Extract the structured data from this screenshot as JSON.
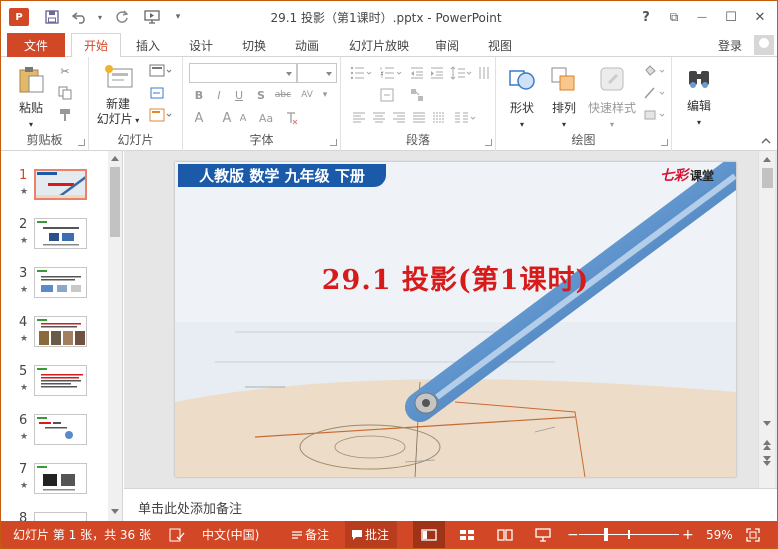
{
  "app": {
    "logo_text": "P",
    "doc_title": "29.1 投影（第1课时）.pptx - PowerPoint"
  },
  "qat": {
    "save_icon": "save-icon",
    "undo_icon": "undo-icon",
    "redo_icon": "redo-icon",
    "present_icon": "from-beginning-icon"
  },
  "window_controls": {
    "help": "?",
    "restore_ribbon": "⧉",
    "minimize": "—",
    "maximize": "☐",
    "close": "✕"
  },
  "tabs": {
    "file": "文件",
    "items": [
      "开始",
      "插入",
      "设计",
      "切换",
      "动画",
      "幻灯片放映",
      "审阅",
      "视图"
    ],
    "active": "开始",
    "login": "登录"
  },
  "ribbon": {
    "clipboard": {
      "label": "剪贴板",
      "paste": "粘贴"
    },
    "slides": {
      "label": "幻灯片",
      "new_slide_line1": "新建",
      "new_slide_line2": "幻灯片"
    },
    "font": {
      "label": "字体",
      "font_name": "",
      "font_size": ""
    },
    "paragraph": {
      "label": "段落"
    },
    "drawing": {
      "label": "绘图",
      "shapes": "形状",
      "arrange": "排列",
      "quick_styles": "快速样式"
    },
    "editing": {
      "label": "编辑",
      "edit": "编辑"
    }
  },
  "thumbnails": {
    "selected": 1,
    "items": [
      {
        "num": "1",
        "star": "★"
      },
      {
        "num": "2",
        "star": "★"
      },
      {
        "num": "3",
        "star": "★"
      },
      {
        "num": "4",
        "star": "★"
      },
      {
        "num": "5",
        "star": "★"
      },
      {
        "num": "6",
        "star": "★"
      },
      {
        "num": "7",
        "star": "★"
      },
      {
        "num": "8",
        "star": "★"
      }
    ]
  },
  "slide": {
    "subject_label": "人教版 数学 九年级 下册",
    "brand_logo": "七彩",
    "brand_text": "课堂",
    "title": "29.1 投影(第1课时)",
    "colors": {
      "title": "#d71a1a",
      "label_bg": "#1a5aa8",
      "brand": "#d8102f"
    }
  },
  "notes": {
    "placeholder": "单击此处添加备注"
  },
  "status": {
    "slide_info": "幻灯片 第 1 张，共 36 张",
    "language": "中文(中国)",
    "notes_btn": "备注",
    "comments_btn": "批注",
    "zoom": "59%",
    "zoom_fraction": 0.59,
    "accent": "#d24726"
  }
}
